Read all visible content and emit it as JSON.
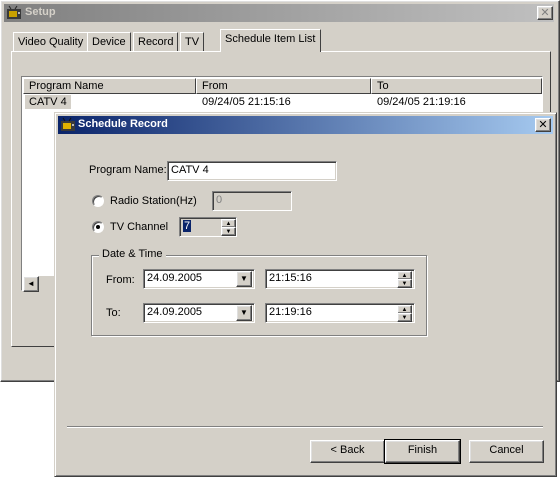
{
  "setup_window": {
    "title": "Setup",
    "close_glyph": "✕",
    "tabs": [
      "Video Quality",
      "Device",
      "Record",
      "TV",
      "Schedule Item List"
    ],
    "active_tab": "Schedule Item List",
    "list": {
      "columns": [
        "Program Name",
        "From",
        "To"
      ],
      "rows": [
        {
          "name": "CATV 4",
          "from": "09/24/05 21:15:16",
          "to": "09/24/05 21:19:16"
        }
      ]
    }
  },
  "dialog": {
    "title": "Schedule Record",
    "close_glyph": "✕",
    "program_name_label": "Program Name:",
    "program_name_value": "CATV 4",
    "radio_station_label": "Radio Station(Hz)",
    "radio_station_value": "0",
    "tv_channel_label": "TV Channel",
    "tv_channel_value": "7",
    "selected_source": "TV Channel",
    "group_title": "Date & Time",
    "from_label": "From:",
    "from_date": "24.09.2005",
    "from_time": "21:15:16",
    "to_label": "To:",
    "to_date": "24.09.2005",
    "to_time": "21:19:16",
    "buttons": {
      "back": "< Back",
      "finish": "Finish",
      "cancel": "Cancel"
    }
  },
  "icons": {
    "app": "tv-app-icon",
    "dropdown": "▼",
    "spin_up": "▲",
    "spin_down": "▼",
    "scroll_left": "◄"
  },
  "colors": {
    "face": "#d4d0c8",
    "active_title_start": "#0a246a",
    "active_title_end": "#a6caf0",
    "inactive_title_start": "#808080",
    "inactive_title_end": "#c0c0c0"
  }
}
